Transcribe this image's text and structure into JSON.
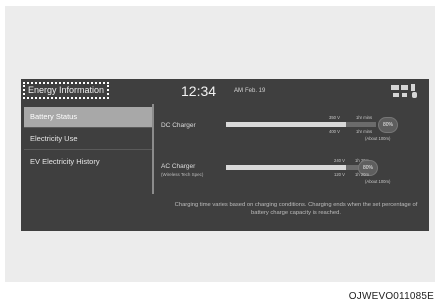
{
  "header": {
    "title": "Energy Information",
    "time": "12:34",
    "ampm": "AM",
    "date": "Feb. 19"
  },
  "sidebar": {
    "items": [
      {
        "label": "Battery Status",
        "active": true
      },
      {
        "label": "Electricity Use",
        "active": false
      },
      {
        "label": "EV Electricity History",
        "active": false
      }
    ]
  },
  "dc_charger": {
    "label": "DC Charger",
    "top_left": "350 V",
    "top_right": "1hr mins",
    "bottom_left": "400 V",
    "bottom_right": "1hr mins",
    "percent_label": "80%",
    "percent": 0.8,
    "note": "(About 100m)"
  },
  "ac_charger": {
    "label": "AC Charger",
    "sublabel": "(Wireless Tech Spec)",
    "top_left": "240 V",
    "top_right": "1h 20m",
    "bottom_left": "120 V",
    "bottom_right": "1h 20m",
    "percent_label": "80%",
    "percent": 0.8,
    "note": "(About 100m)"
  },
  "notice": "Charging time varies based on charging conditions. Charging ends when the set percentage of battery charge capacity is reached.",
  "figure_code": "OJWEVO011085E"
}
